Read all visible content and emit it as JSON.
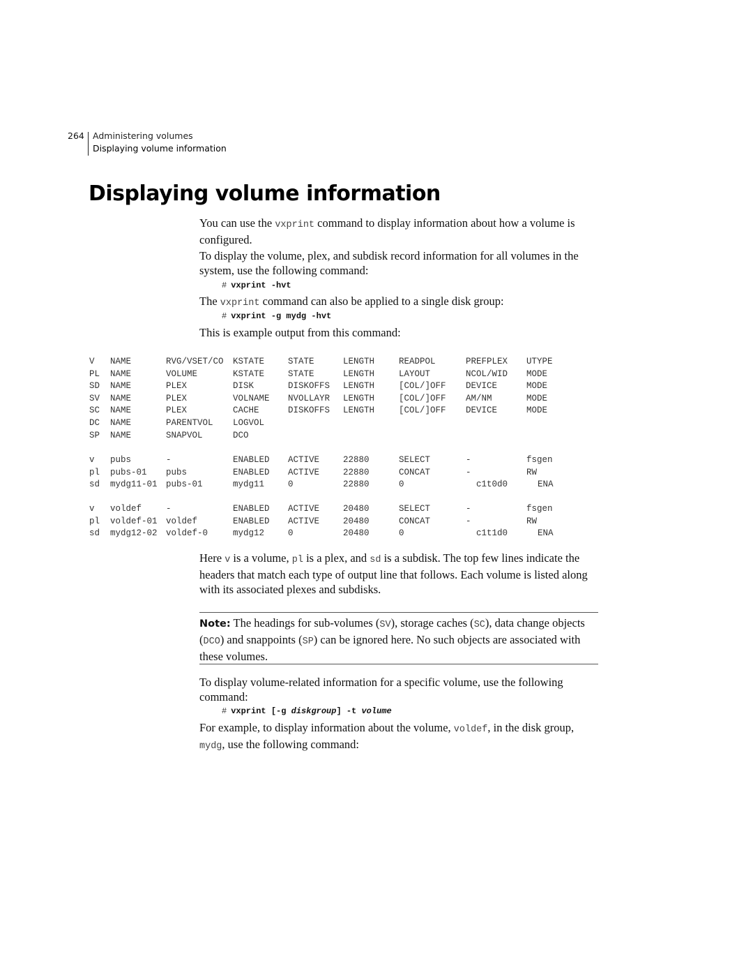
{
  "header": {
    "page_number": "264",
    "chapter": "Administering volumes",
    "section": "Displaying volume information"
  },
  "title": "Displaying volume information",
  "para1": {
    "pre": "You can use the ",
    "code": "vxprint",
    "post": " command to display information about how a volume is configured."
  },
  "para2": "To display the volume, plex, and subdisk record information for all volumes in the system, use the following command:",
  "cmd1": {
    "prompt": "#",
    "text": "vxprint -hvt"
  },
  "para3": {
    "pre": "The ",
    "code": "vxprint",
    "post": " command can also be applied to a single disk group:"
  },
  "cmd2": {
    "prompt": "#",
    "text": "vxprint -g mydg -hvt"
  },
  "para4": "This is example output from this command:",
  "output": {
    "header_rows": [
      [
        "V",
        "NAME",
        "RVG/VSET/CO",
        "KSTATE",
        "STATE",
        "LENGTH",
        "READPOL",
        "PREFPLEX",
        "UTYPE"
      ],
      [
        "PL",
        "NAME",
        "VOLUME",
        "KSTATE",
        "STATE",
        "LENGTH",
        "LAYOUT",
        "NCOL/WID",
        "MODE"
      ],
      [
        "SD",
        "NAME",
        "PLEX",
        "DISK",
        "DISKOFFS",
        "LENGTH",
        "[COL/]OFF",
        "DEVICE",
        "MODE"
      ],
      [
        "SV",
        "NAME",
        "PLEX",
        "VOLNAME",
        "NVOLLAYR",
        "LENGTH",
        "[COL/]OFF",
        "AM/NM",
        "MODE"
      ],
      [
        "SC",
        "NAME",
        "PLEX",
        "CACHE",
        "DISKOFFS",
        "LENGTH",
        "[COL/]OFF",
        "DEVICE",
        "MODE"
      ],
      [
        "DC",
        "NAME",
        "PARENTVOL",
        "LOGVOL",
        "",
        "",
        "",
        "",
        ""
      ],
      [
        "SP",
        "NAME",
        "SNAPVOL",
        "DCO",
        "",
        "",
        "",
        "",
        ""
      ]
    ],
    "group1": [
      [
        "v",
        "pubs",
        "-",
        "ENABLED",
        "ACTIVE",
        "22880",
        "SELECT",
        "-",
        "fsgen"
      ],
      [
        "pl",
        "pubs-01",
        "pubs",
        "ENABLED",
        "ACTIVE",
        "22880",
        "CONCAT",
        "-",
        "RW"
      ],
      [
        "sd",
        "mydg11-01",
        "pubs-01",
        "mydg11",
        "0",
        "22880",
        "0",
        "c1t0d0",
        "ENA"
      ]
    ],
    "group2": [
      [
        "v",
        "voldef",
        "-",
        "ENABLED",
        "ACTIVE",
        "20480",
        "SELECT",
        "-",
        "fsgen"
      ],
      [
        "pl",
        "voldef-01",
        "voldef",
        "ENABLED",
        "ACTIVE",
        "20480",
        "CONCAT",
        "-",
        "RW"
      ],
      [
        "sd",
        "mydg12-02",
        "voldef-0",
        "mydg12",
        "0",
        "20480",
        "0",
        "c1t1d0",
        "ENA"
      ]
    ]
  },
  "para5": {
    "s1": "Here ",
    "c1": "v",
    "s2": " is a volume, ",
    "c2": "pl",
    "s3": " is a plex, and ",
    "c3": "sd",
    "s4": " is a subdisk. The top few lines indicate the headers that match each type of output line that follows. Each volume is listed along with its associated plexes and subdisks."
  },
  "note": {
    "label": "Note:",
    "s1": " The headings for sub-volumes (",
    "c1": "SV",
    "s2": "), storage caches (",
    "c2": "SC",
    "s3": "), data change objects (",
    "c3": "DCO",
    "s4": ") and snappoints (",
    "c4": "SP",
    "s5": ") can be ignored here. No such objects are associated with these volumes."
  },
  "para6": "To display volume-related information for a specific volume, use the following command:",
  "cmd3": {
    "prompt": "#",
    "cmd": "vxprint",
    "opt1": "[-g",
    "arg1": "diskgroup",
    "opt1_end": "]",
    "opt2": "-t",
    "arg2": "volume"
  },
  "para7": {
    "s1": "For example, to display information about the volume, ",
    "c1": "voldef",
    "s2": ", in the disk group, ",
    "c2": "mydg",
    "s3": ", use the following command:"
  }
}
